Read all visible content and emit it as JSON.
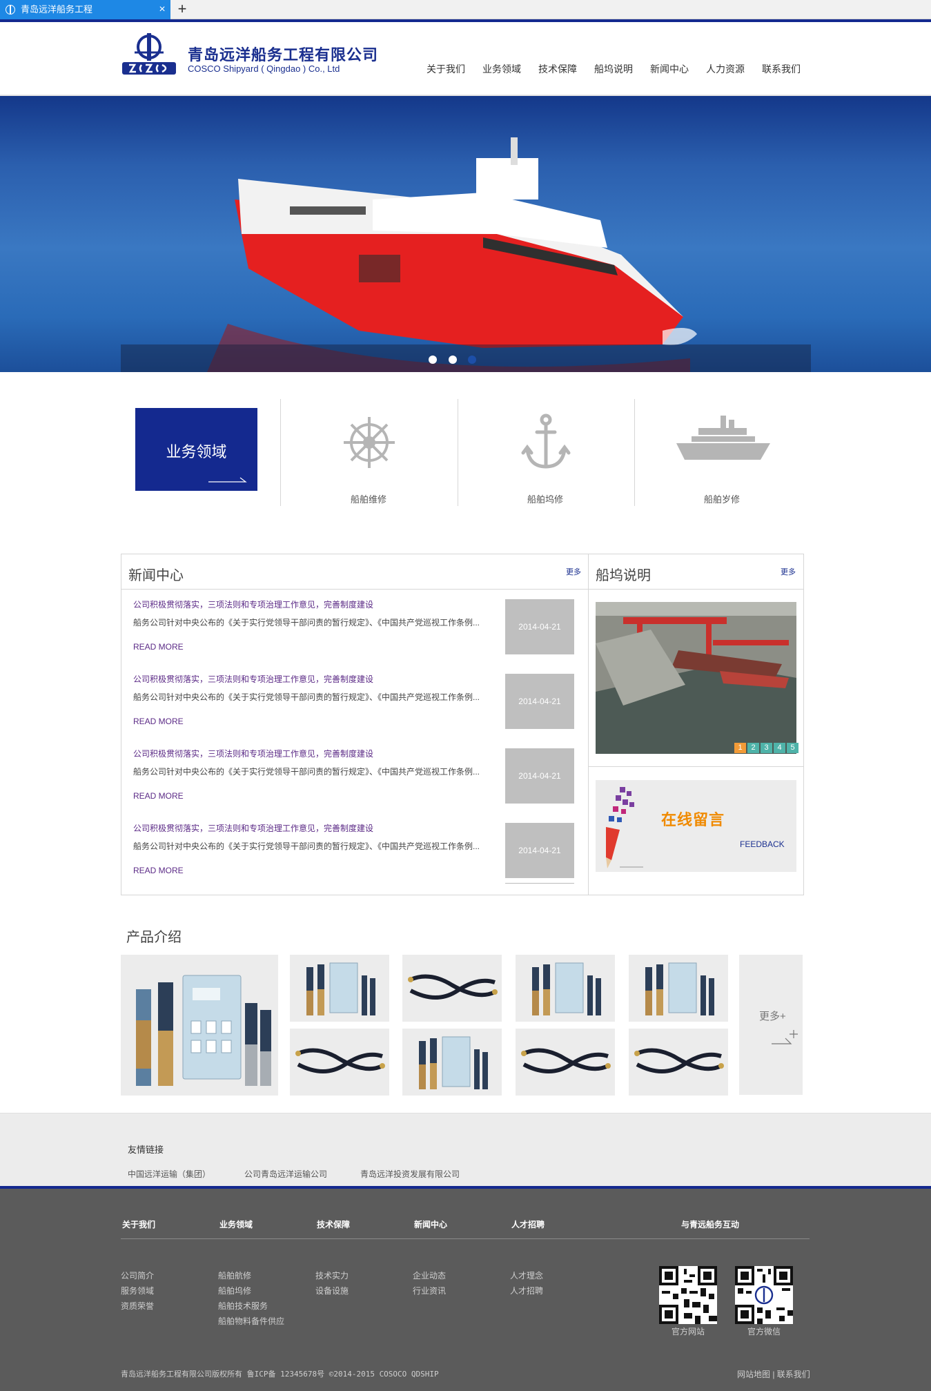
{
  "browser": {
    "tab_title": "青岛远洋船务工程",
    "close_glyph": "×",
    "new_tab_glyph": "+"
  },
  "header": {
    "company_cn": "青岛远洋船务工程有限公司",
    "company_en": "COSCO Shipyard ( Qingdao ) Co., Ltd",
    "nav": [
      "关于我们",
      "业务领域",
      "技术保障",
      "船坞说明",
      "新闻中心",
      "人力资源",
      "联系我们"
    ]
  },
  "banner": {
    "dots": 3,
    "active_dot": 3
  },
  "business": {
    "title": "业务领域",
    "items": [
      {
        "label": "船舶维修",
        "icon": "ship-wheel-icon"
      },
      {
        "label": "船舶坞修",
        "icon": "anchor-icon"
      },
      {
        "label": "船舶岁修",
        "icon": "ship-icon"
      }
    ]
  },
  "news": {
    "title": "新闻中心",
    "more": "更多",
    "items": [
      {
        "title": "公司积极贯彻落实，三项法则和专项治理工作意见，完善制度建设",
        "desc": "船务公司针对中央公布的《关于实行党领导干部问责的暂行规定》、《中国共产党巡视工作条例...",
        "more": "READ MORE",
        "date": "2014-04-21"
      },
      {
        "title": "公司积极贯彻落实，三项法则和专项治理工作意见，完善制度建设",
        "desc": "船务公司针对中央公布的《关于实行党领导干部问责的暂行规定》、《中国共产党巡视工作条例...",
        "more": "READ MORE",
        "date": "2014-04-21"
      },
      {
        "title": "公司积极贯彻落实，三项法则和专项治理工作意见，完善制度建设",
        "desc": "船务公司针对中央公布的《关于实行党领导干部问责的暂行规定》、《中国共产党巡视工作条例...",
        "more": "READ MORE",
        "date": "2014-04-21"
      },
      {
        "title": "公司积极贯彻落实，三项法则和专项治理工作意见，完善制度建设",
        "desc": "船务公司针对中央公布的《关于实行党领导干部问责的暂行规定》、《中国共产党巡视工作条例...",
        "more": "READ MORE",
        "date": "2014-04-21"
      }
    ]
  },
  "dock": {
    "title": "船坞说明",
    "more": "更多",
    "pages": [
      "1",
      "2",
      "3",
      "4",
      "5"
    ],
    "active_page": "1"
  },
  "feedback": {
    "cn": "在线留言",
    "en": "FEEDBACK"
  },
  "products": {
    "title": "产品介绍",
    "more": "更多+"
  },
  "links": {
    "title": "友情链接",
    "items": [
      "中国远洋运输（集团）",
      "公司青岛远洋运输公司",
      "青岛远洋投资发展有限公司"
    ]
  },
  "footer": {
    "columns": [
      {
        "head": "关于我们",
        "items": [
          "公司简介",
          "服务领域",
          "资质荣誉"
        ]
      },
      {
        "head": "业务领域",
        "items": [
          "船舶航修",
          "船舶坞修",
          "船舶技术服务",
          "船舶物料备件供应"
        ]
      },
      {
        "head": "技术保障",
        "items": [
          "技术实力",
          "设备设施"
        ]
      },
      {
        "head": "新闻中心",
        "items": [
          "企业动态",
          "行业资讯"
        ]
      },
      {
        "head": "人才招聘",
        "items": [
          "人才理念",
          "人才招聘"
        ]
      }
    ],
    "interact_head": "与青远船务互动",
    "qr_labels": [
      "官方网站",
      "官方微信"
    ],
    "copyright": "青岛远洋船务工程有限公司版权所有   鲁ICP备 12345678号   ©2014-2015 COSOCO QDSHIP",
    "right_links": "网站地图 | 联系我们"
  },
  "colors": {
    "brand_blue": "#14298f",
    "news_purple": "#5b2a86",
    "feedback_orange": "#f08a00",
    "footer_bg": "#5b5b5b"
  }
}
